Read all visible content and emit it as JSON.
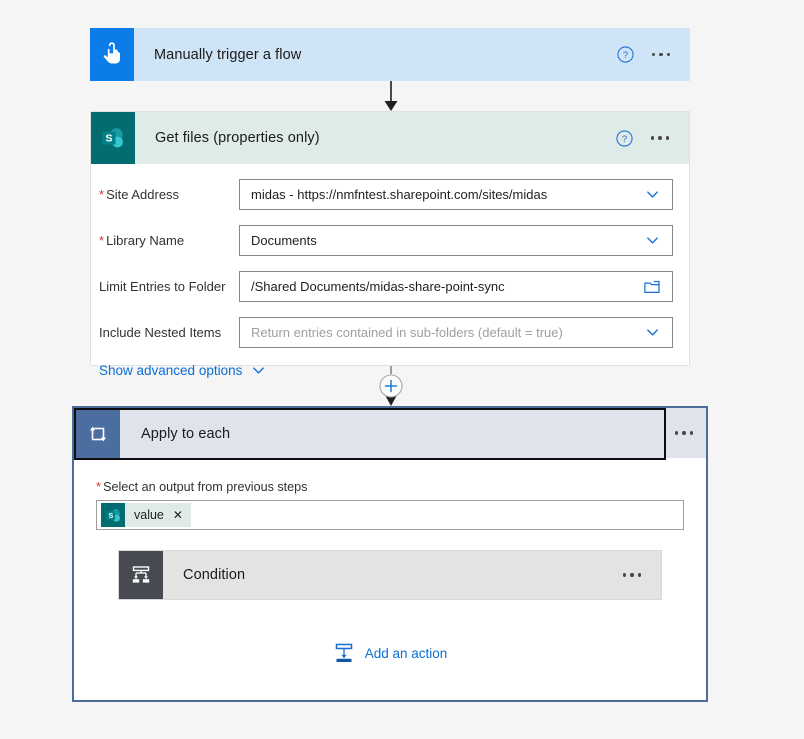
{
  "colors": {
    "canvas_bg": "#f5f5f5",
    "trigger_header": "#cfe4f7",
    "trigger_tile": "#0b7ce8",
    "sharepoint_header": "#dfebe8",
    "sharepoint_tile": "#036c70",
    "foreach_header": "#dfe3ec",
    "foreach_tile": "#4c6d9f",
    "foreach_border": "#4b6d9b",
    "condition_header": "#e3e3e3",
    "condition_tile": "#484a52",
    "accent_link": "#0b6fd4",
    "required_star": "#d13438"
  },
  "trigger_card": {
    "icon": "tap-hand-icon",
    "title": "Manually trigger a flow",
    "help_icon": "help-circle-icon",
    "menu_icon": "more-options-icon"
  },
  "get_files_card": {
    "icon": "sharepoint-icon",
    "title": "Get files (properties only)",
    "help_icon": "help-circle-icon",
    "menu_icon": "more-options-icon",
    "fields": [
      {
        "label": "Site Address",
        "required": true,
        "value": "midas - https://nmfntest.sharepoint.com/sites/midas",
        "is_placeholder": false,
        "trailing_icon": "chevron-down-icon"
      },
      {
        "label": "Library Name",
        "required": true,
        "value": "Documents",
        "is_placeholder": false,
        "trailing_icon": "chevron-down-icon"
      },
      {
        "label": "Limit Entries to Folder",
        "required": false,
        "value": "/Shared Documents/midas-share-point-sync",
        "is_placeholder": false,
        "trailing_icon": "folder-picker-icon"
      },
      {
        "label": "Include Nested Items",
        "required": false,
        "value": "Return entries contained in sub-folders (default = true)",
        "is_placeholder": true,
        "trailing_icon": "chevron-down-icon"
      }
    ],
    "advanced_options_label": "Show advanced options",
    "advanced_options_icon": "chevron-down-icon"
  },
  "insert_button": {
    "icon": "plus-circle-icon",
    "label": "+"
  },
  "apply_to_each": {
    "icon": "foreach-loop-icon",
    "title": "Apply to each",
    "menu_icon": "more-options-icon",
    "selected": true,
    "output_label": "Select an output from previous steps",
    "output_required": true,
    "token": {
      "icon": "sharepoint-icon",
      "label": "value",
      "remove_icon": "close-icon"
    },
    "condition_card": {
      "icon": "condition-branch-icon",
      "title": "Condition",
      "menu_icon": "more-options-icon"
    },
    "add_action": {
      "icon": "add-action-icon",
      "label": "Add an action"
    }
  }
}
